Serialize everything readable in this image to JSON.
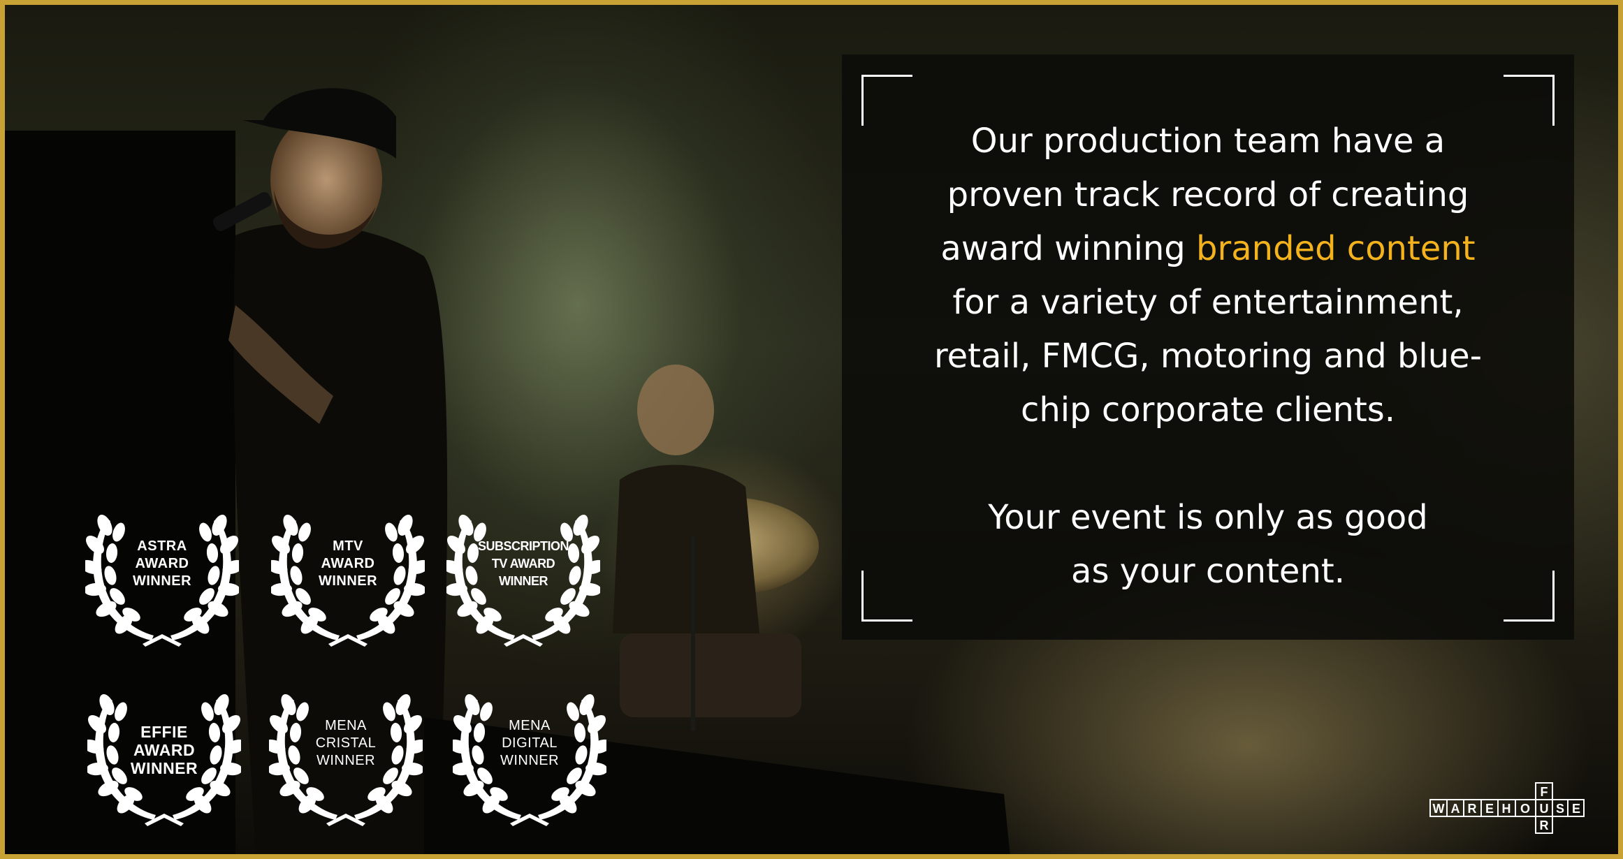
{
  "caption": {
    "line1": "Our production team have a",
    "line2": "proven track record of creating",
    "line3_pre": "award winning ",
    "line3_highlight": "branded content",
    "line4": "for a variety of entertainment,",
    "line5": "retail, FMCG, motoring and blue-",
    "line6": "chip corporate clients.",
    "tagline1": "Your event is only as good",
    "tagline2": "as your content."
  },
  "awards": [
    {
      "lines": [
        "ASTRA",
        "AWARD",
        "WINNER"
      ]
    },
    {
      "lines": [
        "MTV",
        "AWARD",
        "WINNER"
      ]
    },
    {
      "lines": [
        "SUBSCRIPTION",
        "TV AWARD",
        "WINNER"
      ]
    },
    {
      "lines": [
        "EFFIE",
        "AWARD",
        "WINNER"
      ]
    },
    {
      "lines": [
        "MENA",
        "CRISTAL",
        "WINNER"
      ]
    },
    {
      "lines": [
        "MENA",
        "DIGITAL",
        "WINNER"
      ]
    }
  ],
  "logo": {
    "letters": [
      "W",
      "A",
      "R",
      "E",
      "H",
      "O",
      "U",
      "S",
      "E"
    ],
    "top_letter": "F",
    "bottom_letter": "R"
  },
  "colors": {
    "accent": "#f4b21c",
    "border": "#c9a235",
    "text": "#ffffff"
  },
  "icons": [
    "laurel-wreath-icon",
    "viewfinder-corner-icon",
    "warehouse-logo"
  ]
}
